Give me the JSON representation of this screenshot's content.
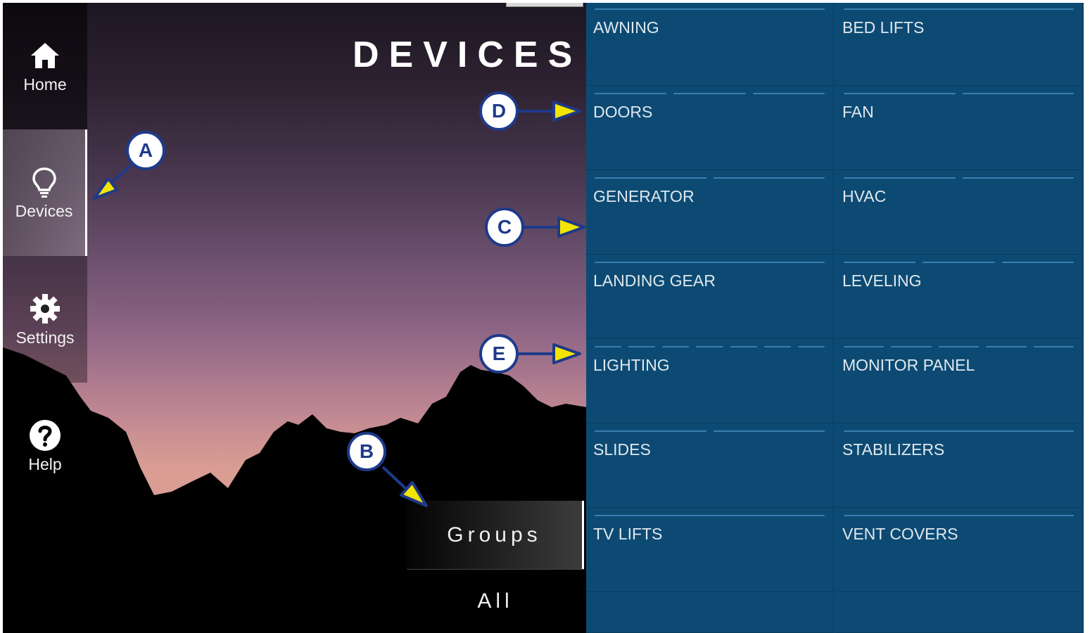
{
  "page_title": "DEVICES",
  "sidebar": {
    "items": [
      {
        "label": "Home",
        "icon": "home-icon"
      },
      {
        "label": "Devices",
        "icon": "lightbulb-icon"
      },
      {
        "label": "Settings",
        "icon": "gear-icon"
      },
      {
        "label": "Help",
        "icon": "help-icon"
      }
    ]
  },
  "view_toggle": {
    "groups_label": "Groups",
    "all_label": "All"
  },
  "device_grid": [
    "AWNING",
    "BED LIFTS",
    "DOORS",
    "FAN",
    "GENERATOR",
    "HVAC",
    "LANDING GEAR",
    "LEVELING",
    "LIGHTING",
    "MONITOR PANEL",
    "SLIDES",
    "STABILIZERS",
    "TV LIFTS",
    "VENT COVERS"
  ],
  "callouts": [
    "A",
    "B",
    "C",
    "D",
    "E"
  ],
  "colors": {
    "grid_bg": "#0d4a73",
    "accent_line": "#3a7fb0",
    "callout_border": "#1e3a8a",
    "callout_arrow": "#f2e600"
  }
}
